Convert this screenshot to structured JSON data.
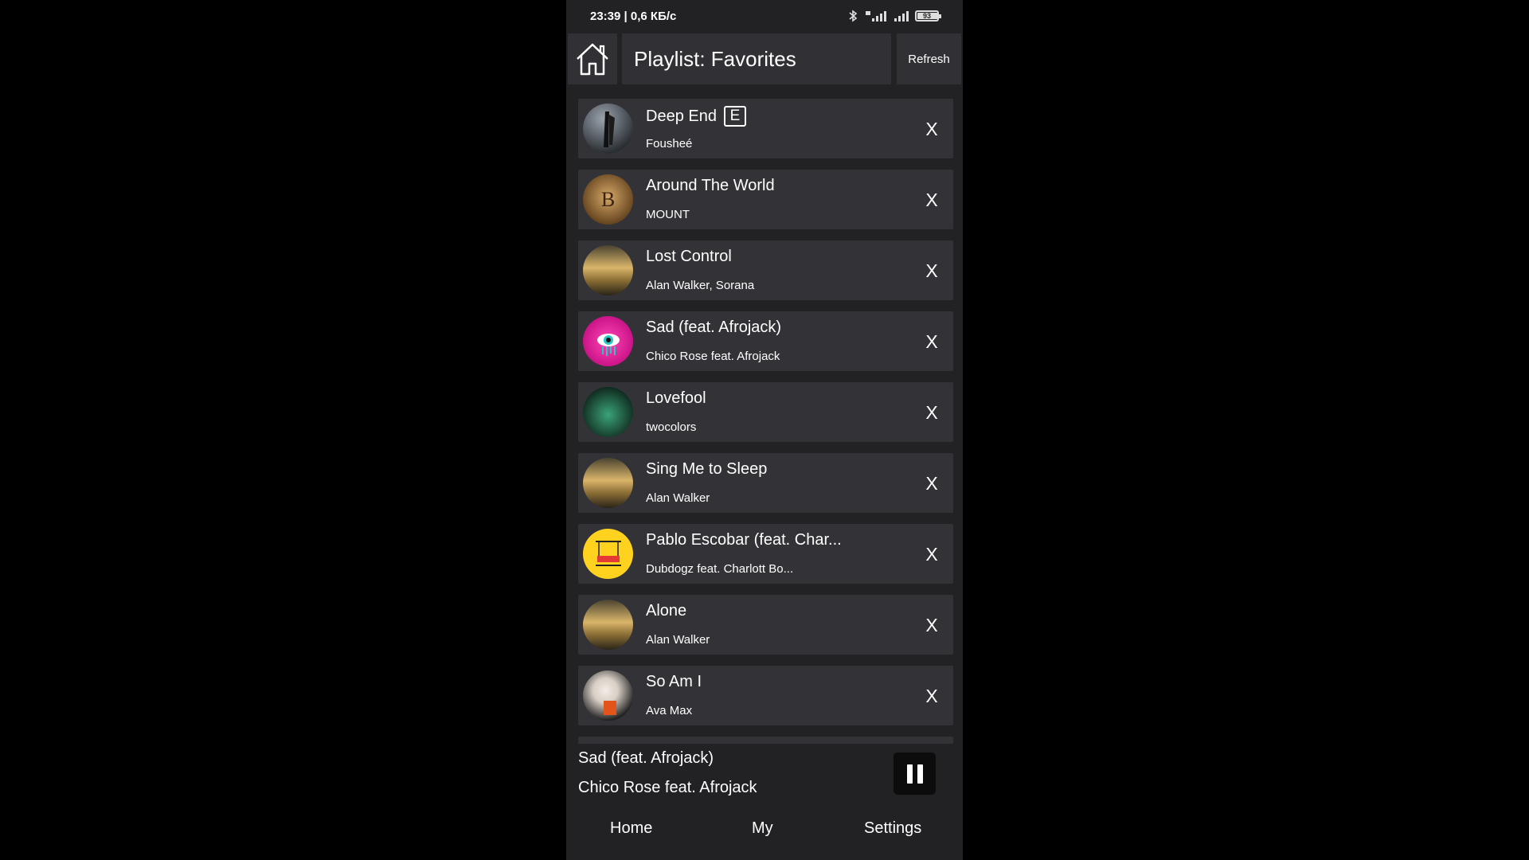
{
  "status_bar": {
    "time": "23:39 | 0,6 КБ/с",
    "battery": "93",
    "icons": [
      "bluetooth-icon",
      "signal-4g-icon",
      "signal-icon",
      "battery-icon"
    ]
  },
  "header": {
    "home_icon": "home-icon",
    "title": "Playlist: Favorites",
    "refresh_label": "Refresh"
  },
  "songs": [
    {
      "title": "Deep End",
      "explicit": "E",
      "artist": "Fousheé",
      "remove_label": "X",
      "cover_colors": [
        "#7d8690",
        "#2a2e33"
      ]
    },
    {
      "title": "Around The World",
      "artist": "MOUNT",
      "remove_label": "X",
      "cover_colors": [
        "#c08f52",
        "#5a3a17"
      ]
    },
    {
      "title": "Lost Control",
      "artist": "Alan Walker, Sorana",
      "remove_label": "X",
      "cover_colors": [
        "#d9b56a",
        "#3c3320"
      ]
    },
    {
      "title": "Sad (feat. Afrojack)",
      "artist": "Chico Rose feat. Afrojack",
      "remove_label": "X",
      "cover_colors": [
        "#ff2aa4",
        "#b0087a"
      ]
    },
    {
      "title": "Lovefool",
      "artist": "twocolors",
      "remove_label": "X",
      "cover_colors": [
        "#2e7d5b",
        "#0c1f17"
      ]
    },
    {
      "title": "Sing Me to Sleep",
      "artist": "Alan Walker",
      "remove_label": "X",
      "cover_colors": [
        "#d9b56a",
        "#3c3320"
      ]
    },
    {
      "title": "Pablo Escobar (feat. Char...",
      "artist": "Dubdogz feat. Charlott Bo...",
      "remove_label": "X",
      "cover_colors": [
        "#ffd21f",
        "#d6a800"
      ]
    },
    {
      "title": "Alone",
      "artist": "Alan Walker",
      "remove_label": "X",
      "cover_colors": [
        "#d9b56a",
        "#3c3320"
      ]
    },
    {
      "title": "So Am I",
      "artist": "Ava Max",
      "remove_label": "X",
      "cover_colors": [
        "#e9e3dd",
        "#1a1a1a"
      ]
    }
  ],
  "now_playing": {
    "title": "Sad (feat. Afrojack)",
    "artist": "Chico Rose feat. Afrojack",
    "control_icon": "pause-icon"
  },
  "bottom_nav": {
    "home": "Home",
    "my": "My",
    "settings": "Settings"
  }
}
